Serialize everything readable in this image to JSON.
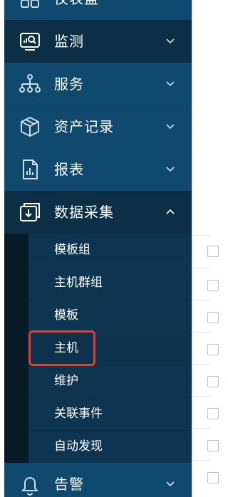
{
  "sidebar": {
    "top_partial_label": "仪表盘",
    "menus": [
      {
        "label": "监测",
        "icon": "monitor-icon",
        "expanded": false
      },
      {
        "label": "服务",
        "icon": "hierarchy-icon",
        "expanded": false
      },
      {
        "label": "资产记录",
        "icon": "box-icon",
        "expanded": false
      },
      {
        "label": "报表",
        "icon": "report-icon",
        "expanded": false
      },
      {
        "label": "数据采集",
        "icon": "download-icon",
        "expanded": true
      },
      {
        "label": "告警",
        "icon": "bell-icon",
        "expanded": false
      }
    ],
    "submenu": [
      {
        "label": "模板组"
      },
      {
        "label": "主机群组"
      },
      {
        "label": "模板"
      },
      {
        "label": "主机",
        "selected": true
      },
      {
        "label": "维护"
      },
      {
        "label": "关联事件"
      },
      {
        "label": "自动发现"
      }
    ]
  },
  "colors": {
    "sidebar_bg": "#0f4a6e",
    "active_bg": "#0c2f45",
    "submenu_bg": "#0d3551",
    "highlight": "#e0412d",
    "selected_bar": "#5aa9f0"
  }
}
